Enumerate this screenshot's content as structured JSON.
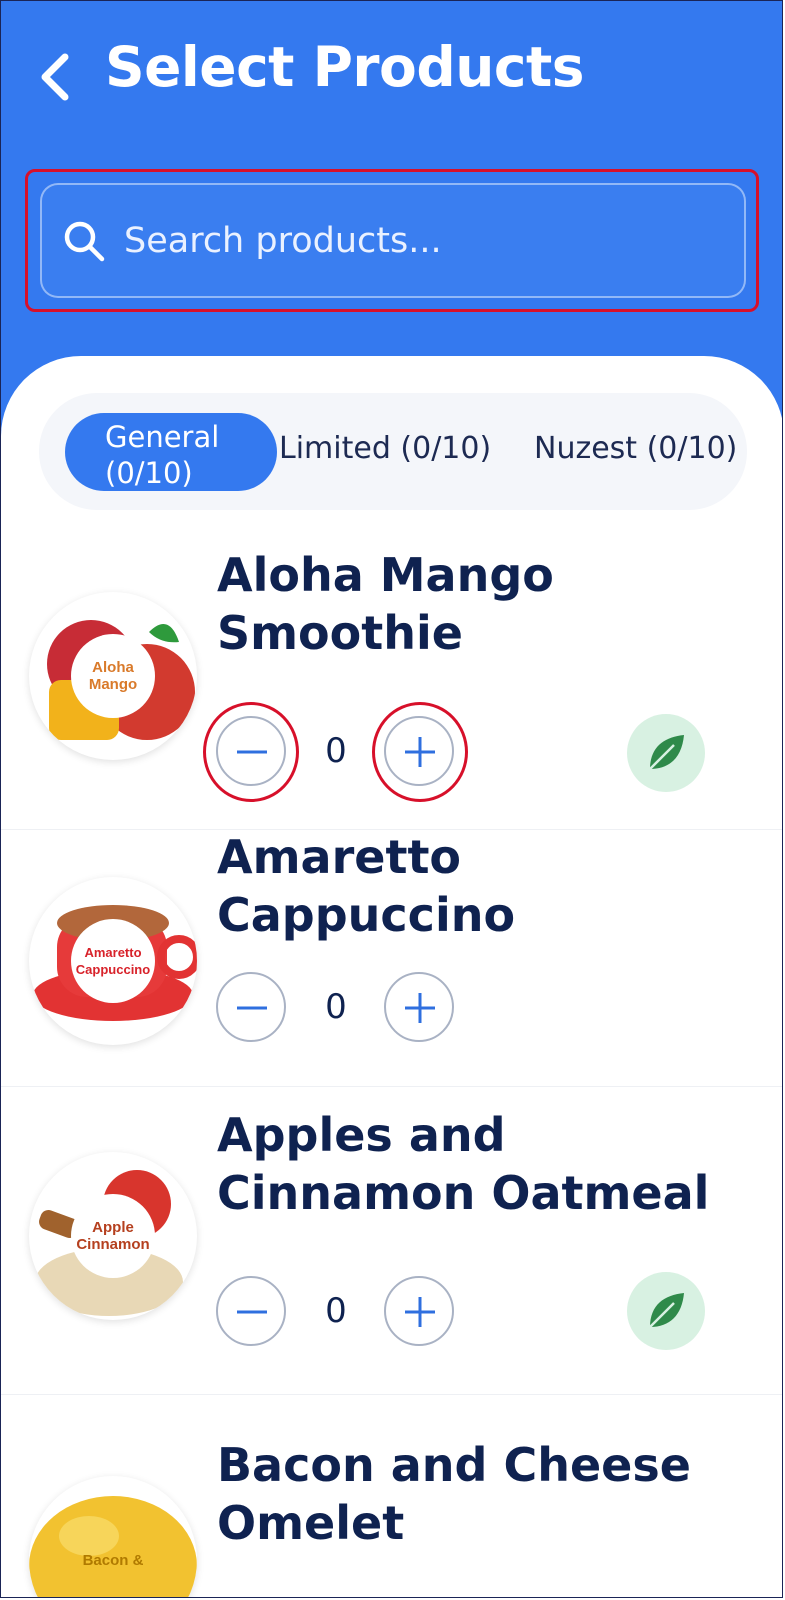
{
  "header": {
    "title": "Select Products",
    "back_icon": "chevron-left-icon",
    "background_color": "#3479ef"
  },
  "search": {
    "placeholder": "Search products...",
    "value": "",
    "icon": "search-icon"
  },
  "tabs": [
    {
      "label": "General (0/10)",
      "selected": true
    },
    {
      "label": "Limited (0/10)",
      "selected": false
    },
    {
      "label": "Nuzest (0/10)",
      "selected": false
    }
  ],
  "products": [
    {
      "name": "Aloha Mango Smoothie",
      "thumb_text": "Aloha Mango",
      "quantity": "0",
      "vegan": true,
      "thumb_color": "#d97a2a"
    },
    {
      "name": "Amaretto Cappuccino",
      "thumb_text": "Amaretto Cappuccino",
      "quantity": "0",
      "vegan": false,
      "thumb_color": "#e02a2a"
    },
    {
      "name": "Apples and Cinnamon Oatmeal",
      "thumb_text": "Apple Cinnamon",
      "quantity": "0",
      "vegan": true,
      "thumb_color": "#b5401f"
    },
    {
      "name": "Bacon and Cheese Omelet",
      "thumb_text": "Bacon &",
      "quantity": "",
      "vegan": false,
      "thumb_color": "#f0b400"
    }
  ],
  "colors": {
    "accent": "#3479ef",
    "title_text": "#0f2250",
    "highlight": "#d7102a",
    "vegan_badge": "#d8f1e2",
    "leaf": "#2f8a4a"
  }
}
